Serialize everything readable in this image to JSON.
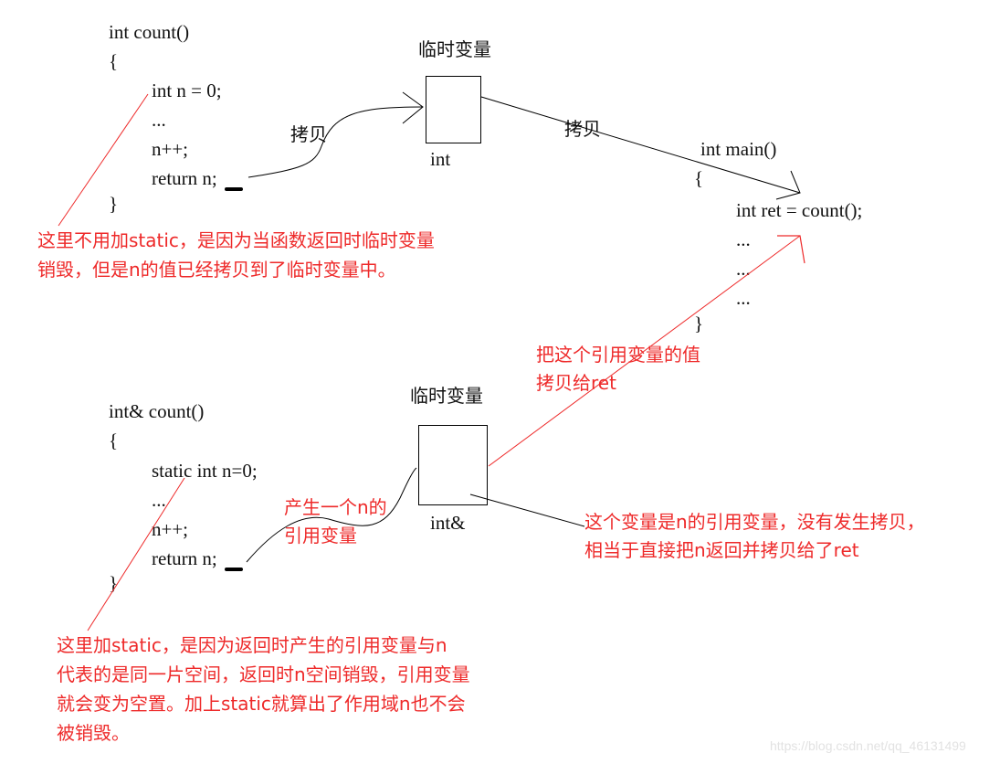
{
  "top_function": {
    "lines": [
      "int count()",
      "{",
      "int n = 0;",
      "...",
      "n++;",
      "return n;",
      "}"
    ]
  },
  "top_temp": {
    "title": "临时变量",
    "type_label": "int"
  },
  "top_copy_labels": [
    "拷贝",
    "拷贝"
  ],
  "top_note": "这里不用加static，是因为当函数返回时临时变量\n销毁，但是n的值已经拷贝到了临时变量中。",
  "main_function": {
    "lines": [
      "int main()",
      "{",
      "int ret = count();",
      "...",
      "...",
      "...",
      "}"
    ]
  },
  "bottom_function": {
    "lines": [
      "int& count()",
      "{",
      "static int n=0;",
      "...",
      "n++;",
      "return n;",
      "}"
    ]
  },
  "bottom_temp": {
    "title": "临时变量",
    "type_label": "int&"
  },
  "ref_label": "产生一个n的\n引用变量",
  "copy_to_ret_label": "把这个引用变量的值\n拷贝给ret",
  "ref_note": "这个变量是n的引用变量，没有发生拷贝，\n相当于直接把n返回并拷贝给了ret",
  "bottom_note": "这里加static，是因为返回时产生的引用变量与n\n代表的是同一片空间，返回时n空间销毁，引用变量\n就会变为空置。加上static就算出了作用域n也不会\n被销毁。",
  "watermark": "https://blog.csdn.net/qq_46131499",
  "colors": {
    "annotation": "#ee2a2a",
    "ink": "#111111"
  }
}
